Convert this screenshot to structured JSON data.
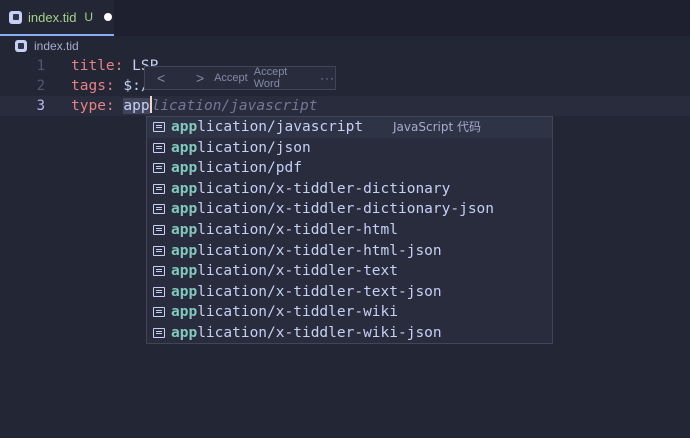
{
  "tab": {
    "name": "index.tid",
    "status": "U"
  },
  "breadcrumb": {
    "label": "index.tid"
  },
  "editor": {
    "lines": [
      {
        "number": "1",
        "key": "title:",
        "value": " LSP"
      },
      {
        "number": "2",
        "key": "tags:",
        "value": " $:/"
      },
      {
        "number": "3",
        "key": "type:",
        "typed": "app",
        "ghost": "lication/javascript"
      }
    ]
  },
  "inline_hint": {
    "prev": "<",
    "next": ">",
    "accept": "Accept",
    "accept_word": "Accept Word",
    "more": "···"
  },
  "suggestions": {
    "match": "app",
    "items": [
      {
        "rest": "lication/javascript",
        "detail": "JavaScript 代码"
      },
      {
        "rest": "lication/json"
      },
      {
        "rest": "lication/pdf"
      },
      {
        "rest": "lication/x-tiddler-dictionary"
      },
      {
        "rest": "lication/x-tiddler-dictionary-json"
      },
      {
        "rest": "lication/x-tiddler-html"
      },
      {
        "rest": "lication/x-tiddler-html-json"
      },
      {
        "rest": "lication/x-tiddler-text"
      },
      {
        "rest": "lication/x-tiddler-text-json"
      },
      {
        "rest": "lication/x-tiddler-wiki"
      },
      {
        "rest": "lication/x-tiddler-wiki-json"
      }
    ]
  }
}
